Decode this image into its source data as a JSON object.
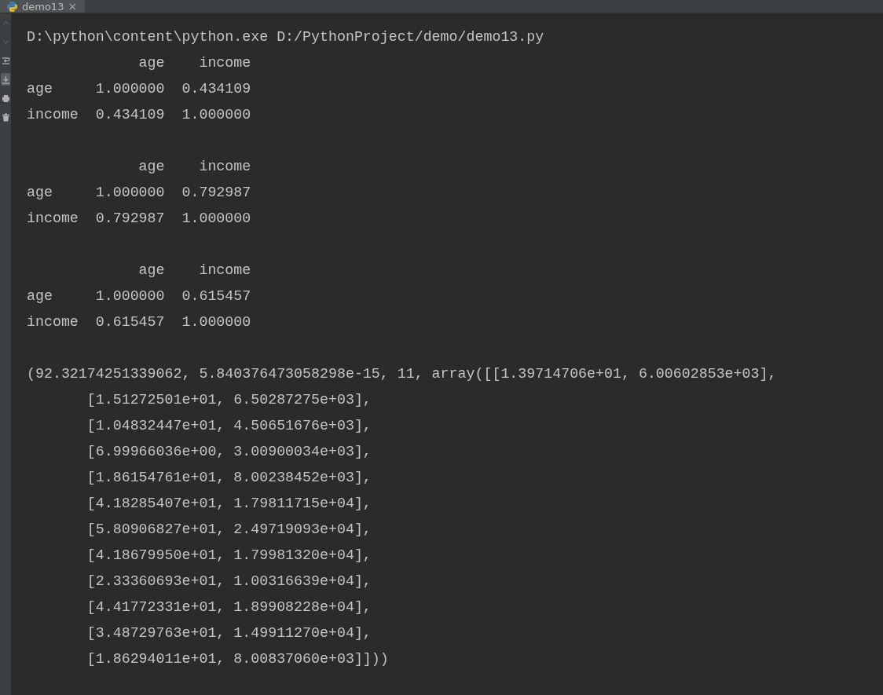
{
  "tabs": [
    {
      "label": "demo13",
      "selected": true,
      "close": "×"
    }
  ],
  "console": {
    "blocks": [
      {
        "lines": [
          "D:\\python\\content\\python.exe D:/PythonProject/demo/demo13.py",
          "             age    income",
          "age     1.000000  0.434109",
          "income  0.434109  1.000000"
        ]
      },
      {
        "lines": [
          "             age    income",
          "age     1.000000  0.792987",
          "income  0.792987  1.000000"
        ]
      },
      {
        "lines": [
          "             age    income",
          "age     1.000000  0.615457",
          "income  0.615457  1.000000"
        ]
      },
      {
        "lines": [
          "(92.32174251339062, 5.840376473058298e-15, 11, array([[1.39714706e+01, 6.00602853e+03],",
          "       [1.51272501e+01, 6.50287275e+03],",
          "       [1.04832447e+01, 4.50651676e+03],",
          "       [6.99966036e+00, 3.00900034e+03],",
          "       [1.86154761e+01, 8.00238452e+03],",
          "       [4.18285407e+01, 1.79811715e+04],",
          "       [5.80906827e+01, 2.49719093e+04],",
          "       [4.18679950e+01, 1.79981320e+04],",
          "       [2.33360693e+01, 1.00316639e+04],",
          "       [4.41772331e+01, 1.89908228e+04],",
          "       [3.48729763e+01, 1.49911270e+04],",
          "       [1.86294011e+01, 8.00837060e+03]]))"
        ]
      }
    ]
  },
  "toolbar": [
    {
      "kind": "up",
      "disabled": true
    },
    {
      "kind": "down",
      "disabled": true
    },
    {
      "kind": "wrap",
      "disabled": false
    },
    {
      "kind": "scroll-end",
      "disabled": false,
      "selected": true
    },
    {
      "kind": "print",
      "disabled": false
    },
    {
      "kind": "trash",
      "disabled": false
    }
  ]
}
